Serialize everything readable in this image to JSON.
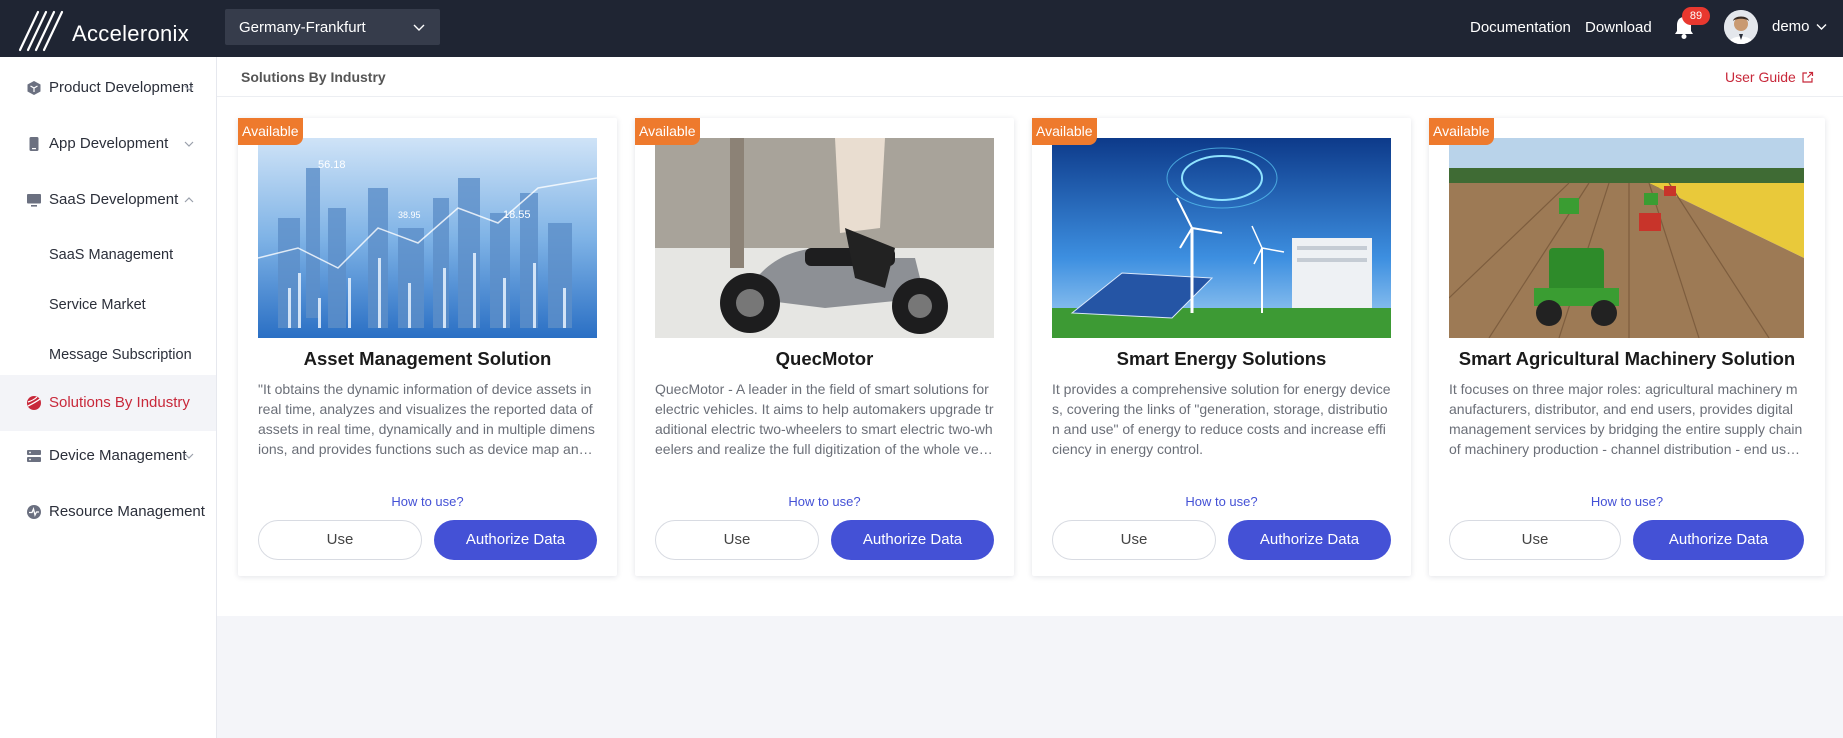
{
  "header": {
    "logo_text": "Acceleronix",
    "region": "Germany-Frankfurt",
    "links": {
      "documentation": "Documentation",
      "download": "Download"
    },
    "notification_count": "89",
    "user": "demo"
  },
  "sidebar": {
    "items": [
      {
        "label": "Product Development",
        "icon": "cube-icon"
      },
      {
        "label": "App Development",
        "icon": "phone-icon"
      },
      {
        "label": "SaaS Development",
        "icon": "monitor-icon"
      },
      {
        "label": "SaaS Management"
      },
      {
        "label": "Service Market"
      },
      {
        "label": "Message Subscription"
      },
      {
        "label": "Solutions By Industry",
        "icon": "industry-icon"
      },
      {
        "label": "Device Management",
        "icon": "device-icon"
      },
      {
        "label": "Resource Management",
        "icon": "resource-icon"
      }
    ]
  },
  "page": {
    "title": "Solutions By Industry",
    "user_guide": "User Guide"
  },
  "colors": {
    "accent": "#4451d6",
    "brand_red": "#c8283a",
    "tag": "#ee7a2d",
    "header": "#1f2533"
  },
  "cards": [
    {
      "tag": "Available",
      "title": "Asset Management Solution",
      "description": "\"It obtains the dynamic information of device assets in real time, analyzes and visualizes the reported data of assets in real time, dynamically and in multiple dimensions, and provides functions such as device map and other features for asset management.",
      "how_to": "How to use?",
      "use": "Use",
      "authorize": "Authorize Data"
    },
    {
      "tag": "Available",
      "title": "QuecMotor",
      "description": "QuecMotor - A leader in the field of smart solutions for electric vehicles. It aims to help automakers upgrade traditional electric two-wheelers to smart electric two-wheelers and realize the full digitization of the whole vehicle.",
      "how_to": "How to use?",
      "use": "Use",
      "authorize": "Authorize Data"
    },
    {
      "tag": "Available",
      "title": "Smart Energy Solutions",
      "description": "It provides a comprehensive solution for energy devices, covering the links of \"generation, storage, distribution and use\" of energy to reduce costs and increase efficiency in energy control.",
      "how_to": "How to use?",
      "use": "Use",
      "authorize": "Authorize Data"
    },
    {
      "tag": "Available",
      "title": "Smart Agricultural Machinery Solution",
      "description": "It focuses on three major roles: agricultural machinery manufacturers, distributor, and end users, provides digital management services by bridging the entire supply chain of machinery production - channel distribution - end users.",
      "how_to": "How to use?",
      "use": "Use",
      "authorize": "Authorize Data"
    }
  ]
}
